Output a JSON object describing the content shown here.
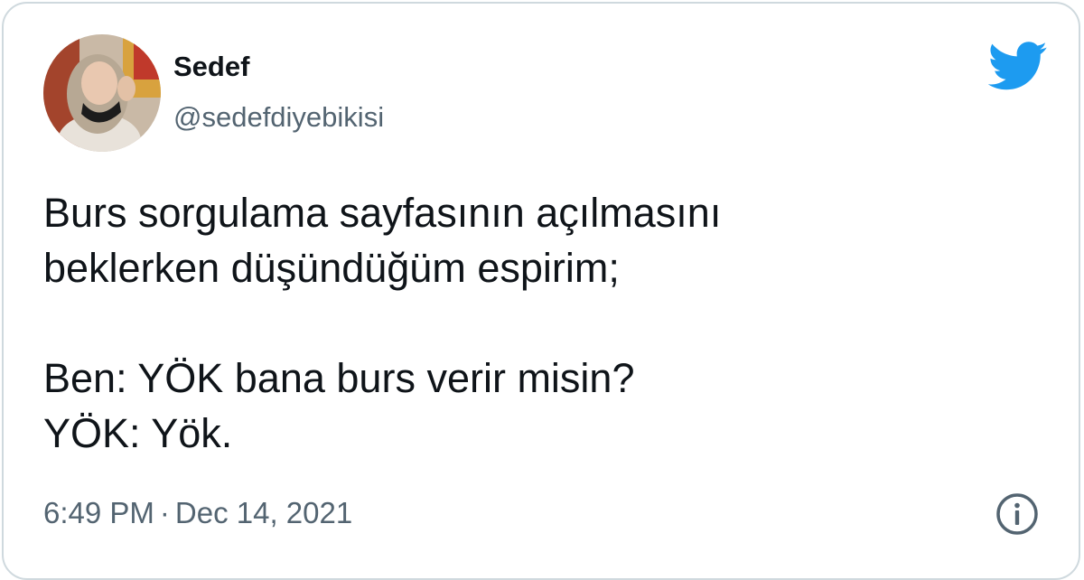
{
  "author": {
    "name": "Sedef",
    "handle": "@sedefdiyebikisi"
  },
  "tweet": {
    "lines": [
      "Burs sorgulama sayfasının açılmasını",
      "beklerken düşündüğüm espirim;",
      "",
      "Ben: YÖK bana burs verir misin?",
      "YÖK: Yök."
    ]
  },
  "meta": {
    "time": "6:49 PM",
    "separator": "·",
    "date": "Dec 14, 2021"
  },
  "icons": {
    "logo": "twitter-bird-icon",
    "info": "info-icon"
  },
  "colors": {
    "brand": "#1d9bf0",
    "text": "#0f1419",
    "secondary": "#536471",
    "border": "#cfd9de"
  }
}
